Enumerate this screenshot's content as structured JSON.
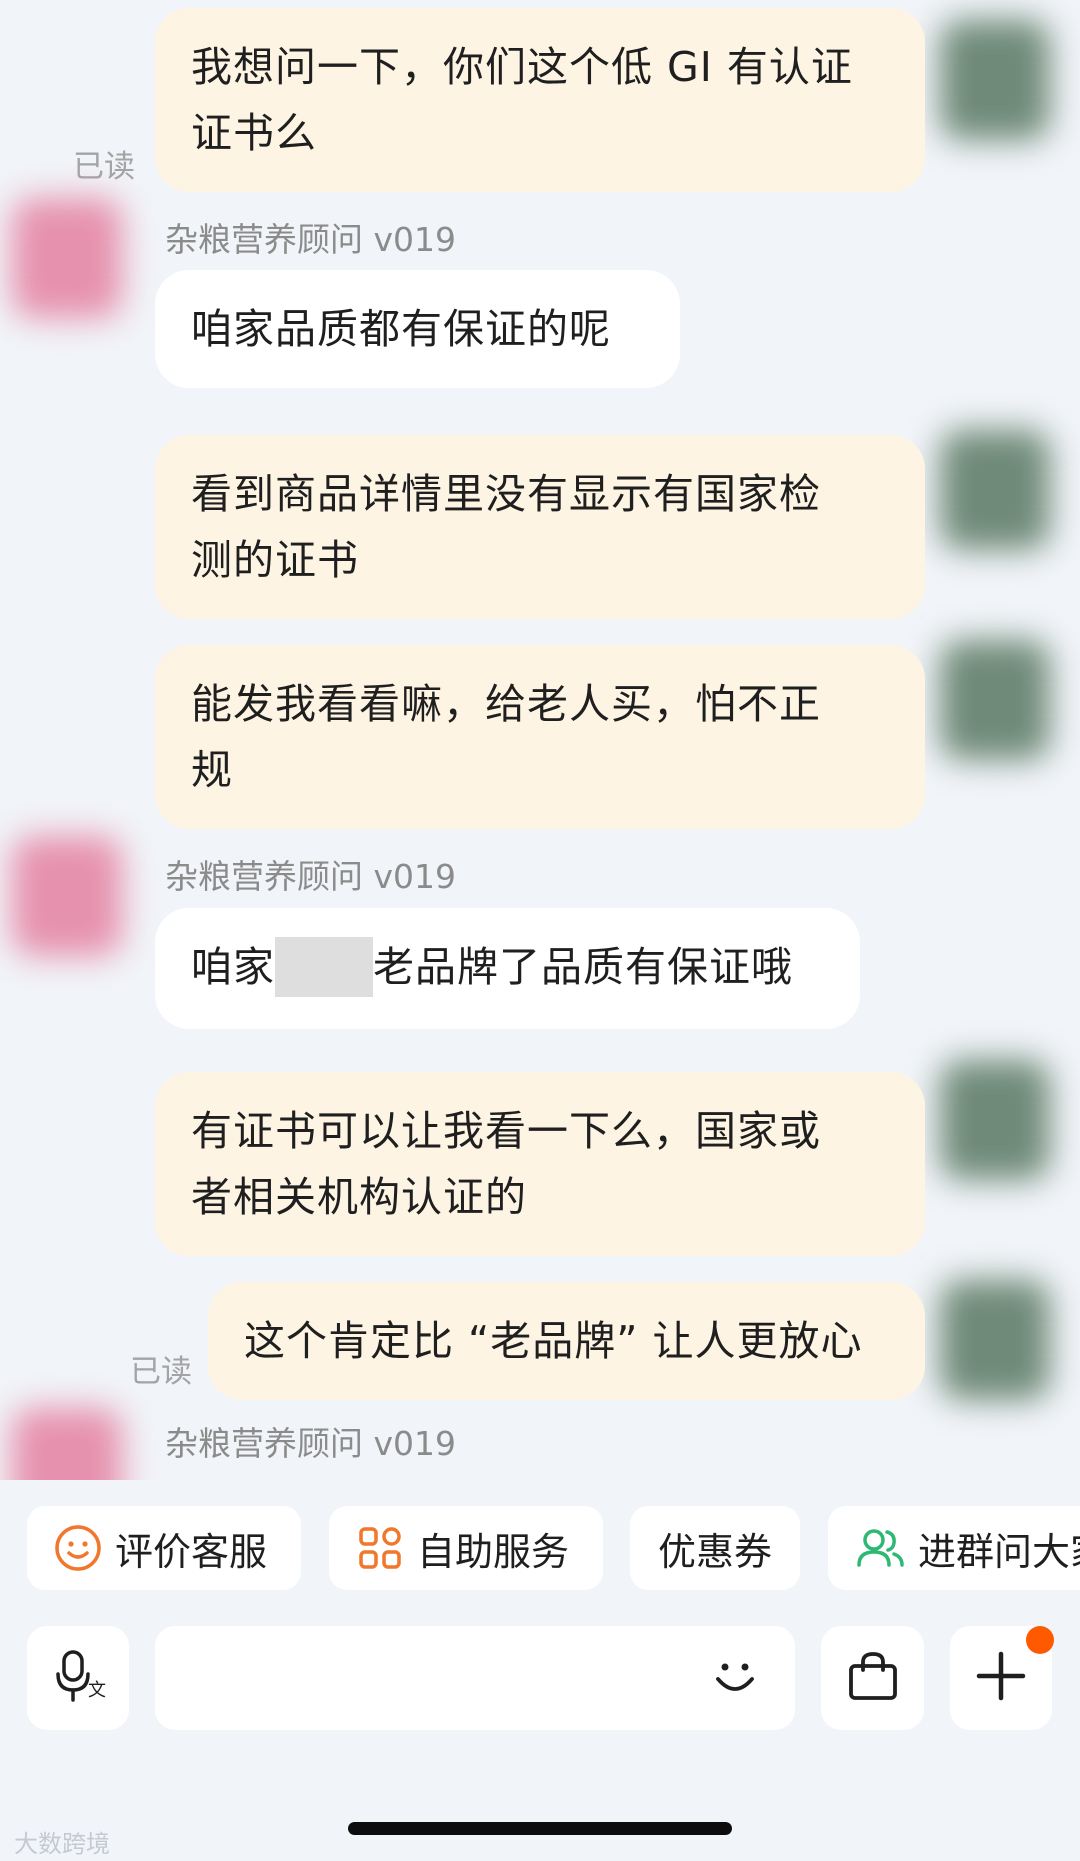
{
  "messages": [
    {
      "text_line1": "我想问一下，你们这个低 GI 有认证",
      "text_line2": "证书么"
    },
    {
      "sender": "杂粮营养顾问 v019",
      "text": "咱家品质都有保证的呢"
    },
    {
      "text_line1": "看到商品详情里没有显示有国家检",
      "text_line2": "测的证书"
    },
    {
      "text_line1": "能发我看看嘛，给老人买，怕不正",
      "text_line2": "规"
    },
    {
      "sender": "杂粮营养顾问 v019",
      "text_before": "咱家",
      "text_after": "老品牌了品质有保证哦"
    },
    {
      "text_line1": "有证书可以让我看一下么，国家或",
      "text_line2": "者相关机构认证的"
    },
    {
      "text": "这个肯定比 “老品牌” 让人更放心"
    },
    {
      "sender": "杂粮营养顾问 v019"
    }
  ],
  "read_status": {
    "first": "已读",
    "second": "已读"
  },
  "quick_actions": [
    {
      "label": "评价客服",
      "icon": "smiley-icon"
    },
    {
      "label": "自助服务",
      "icon": "grid-icon"
    },
    {
      "label": "优惠券"
    },
    {
      "label": "进群问大家",
      "icon": "group-icon"
    }
  ],
  "input_bar": {
    "voice_icon": "mic-translate-icon",
    "emoji_icon": "emoji-icon",
    "bag_icon": "shopping-bag-icon",
    "plus_icon": "plus-icon",
    "badge_color": "#ff5a00"
  },
  "watermark": "大数跨境"
}
